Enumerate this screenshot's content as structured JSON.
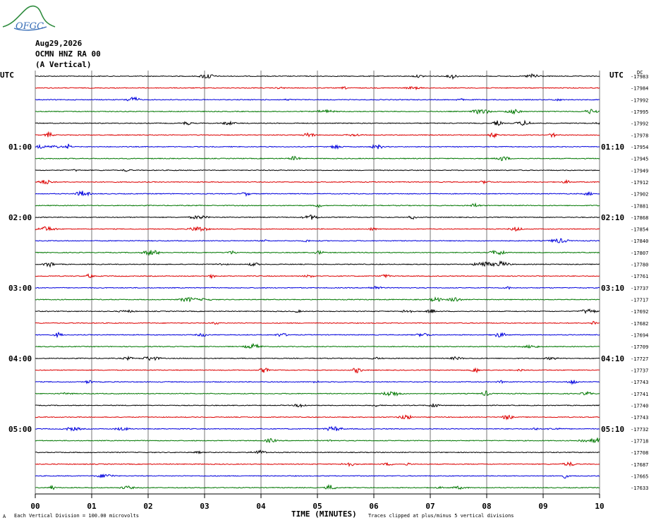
{
  "header": {
    "logo_text": "OFGC",
    "date": "Aug29,2026",
    "station": "OCMN HNZ RA 00",
    "component": "(A Vertical)"
  },
  "chart_data": {
    "type": "line",
    "title": "",
    "left_axis_label": "UTC",
    "right_axis_label": "UTC",
    "right_top_label": "DC",
    "left_time_labels": [
      "01:00",
      "02:00",
      "03:00",
      "04:00",
      "05:00"
    ],
    "right_time_labels": [
      "01:10",
      "02:10",
      "03:10",
      "04:10",
      "05:10"
    ],
    "x_tick_labels": [
      "00",
      "01",
      "02",
      "03",
      "04",
      "05",
      "06",
      "07",
      "08",
      "09",
      "10"
    ],
    "xlabel": "TIME (MINUTES)",
    "xlim": [
      0,
      10
    ],
    "grid": true,
    "trace_colors": [
      "#000000",
      "#dd0000",
      "#0000dd",
      "#007700"
    ],
    "dc_offsets": [
      "-17983",
      "-17984",
      "-17992",
      "-17995",
      "-17992",
      "-17978",
      "-17954",
      "-17945",
      "-17949",
      "-17912",
      "-17902",
      "-17881",
      "-17868",
      "-17854",
      "-17840",
      "-17807",
      "-17780",
      "-17761",
      "-17737",
      "-17717",
      "-17692",
      "-17682",
      "-17694",
      "-17709",
      "-17727",
      "-17737",
      "-17743",
      "-17741",
      "-17740",
      "-17743",
      "-17732",
      "-17718",
      "-17708",
      "-17687",
      "-17665",
      "-17633"
    ],
    "footnote_left": "Each Vertical Division =  100.00 microvolts",
    "footnote_right": "Traces clipped at plus/minus 5 vertical divisions",
    "footnote_mark": "A"
  }
}
